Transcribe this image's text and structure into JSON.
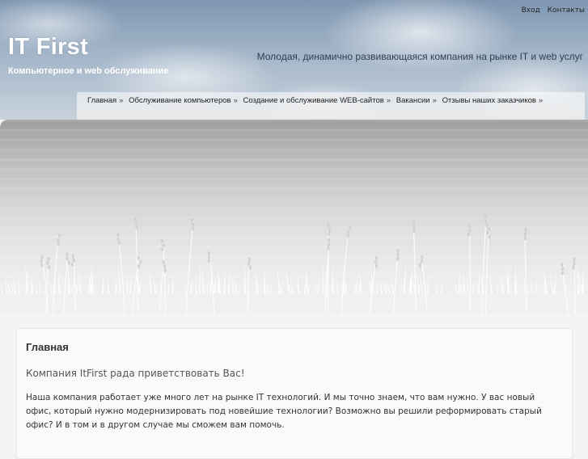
{
  "header": {
    "top_links": [
      "Вход",
      "Контакты"
    ],
    "site_title": "IT First",
    "site_subtitle": "Компьютерное и web обслуживание",
    "slogan": "Молодая, динамично развивающаяся компания на рынке IT и web услуг"
  },
  "nav": {
    "items": [
      {
        "label": "Главная"
      },
      {
        "label": "Обслуживание компьютеров"
      },
      {
        "label": "Создание и обслуживание WEB-сайтов"
      },
      {
        "label": "Вакансии"
      },
      {
        "label": "Отзывы наших заказчиков"
      }
    ],
    "separator": "»"
  },
  "content": {
    "heading": "Главная",
    "lead": "Компания ItFirst рада приветствовать Вас!",
    "paragraph": "Наша компания работает уже много лет на рынке IT технологий. И мы точно знаем, что вам нужно. У вас новый офис, который нужно модернизировать под новейшие технологии? Возможно вы решили реформировать старый офис? И в том и в другом случае мы сможем вам помочь."
  }
}
